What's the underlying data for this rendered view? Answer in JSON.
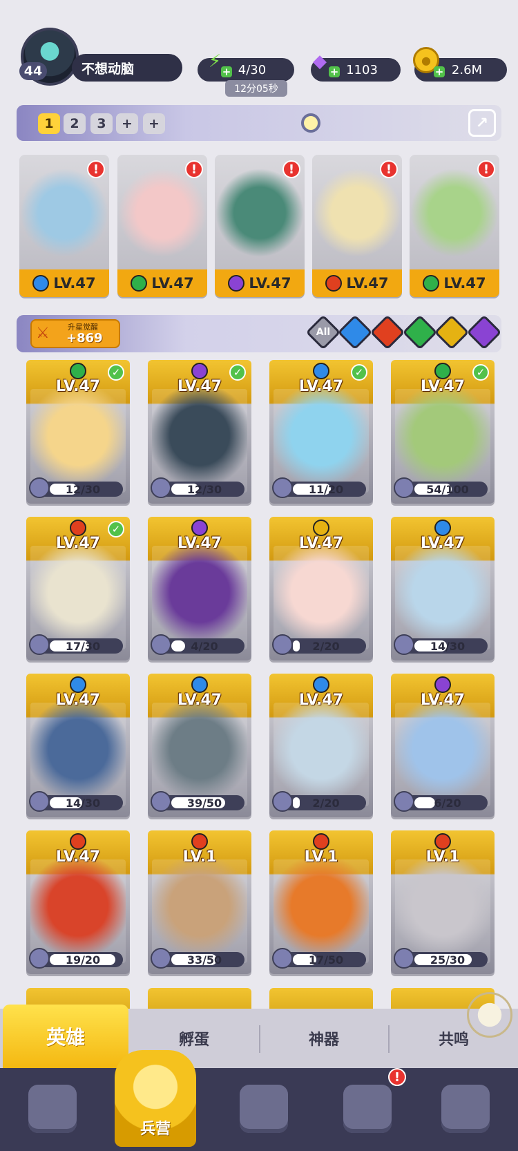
{
  "player": {
    "level": "44",
    "name": "不想动脑"
  },
  "resources": {
    "energy": {
      "value": "4/30",
      "timer": "12分05秒",
      "icon": "lightning-icon"
    },
    "gems": {
      "value": "1103",
      "icon": "diamond-icon"
    },
    "gold": {
      "value": "2.6M",
      "icon": "coin-icon"
    }
  },
  "team_tabs": [
    "1",
    "2",
    "3",
    "+",
    "+"
  ],
  "team": [
    {
      "level": "LV.47",
      "element": "water",
      "color": "#2f8ae8",
      "art": "#9ec9e4"
    },
    {
      "level": "LV.47",
      "element": "wind",
      "color": "#2fb04a",
      "art": "#f3c8c8"
    },
    {
      "level": "LV.47",
      "element": "shadow",
      "color": "#8a43d3",
      "art": "#4a8a78"
    },
    {
      "level": "LV.47",
      "element": "fire",
      "color": "#e0401f",
      "art": "#efe1b0"
    },
    {
      "level": "LV.47",
      "element": "wind",
      "color": "#2fb04a",
      "art": "#a8d38a"
    }
  ],
  "awaken": {
    "label": "升星觉醒",
    "value": "+869"
  },
  "filters": [
    {
      "label": "All",
      "color": "#9a9aa8"
    },
    {
      "label": "",
      "color": "#2f8ae8"
    },
    {
      "label": "",
      "color": "#e0401f"
    },
    {
      "label": "",
      "color": "#2fb04a"
    },
    {
      "label": "",
      "color": "#e5b212"
    },
    {
      "label": "",
      "color": "#8a43d3"
    }
  ],
  "heroes": [
    {
      "level": "LV.47",
      "shards": "12/30",
      "progress": 0.4,
      "element": "wind",
      "color": "#2fb04a",
      "check": true,
      "art": "#f5d58b"
    },
    {
      "level": "LV.47",
      "shards": "12/30",
      "progress": 0.4,
      "element": "shadow",
      "color": "#8a43d3",
      "check": true,
      "art": "#3a4b5a"
    },
    {
      "level": "LV.47",
      "shards": "11/20",
      "progress": 0.55,
      "element": "water",
      "color": "#2f8ae8",
      "check": true,
      "art": "#8fd3ee"
    },
    {
      "level": "LV.47",
      "shards": "54/100",
      "progress": 0.54,
      "element": "wind",
      "color": "#2fb04a",
      "check": true,
      "art": "#a3c97a"
    },
    {
      "level": "LV.47",
      "shards": "17/30",
      "progress": 0.57,
      "element": "fire",
      "color": "#e0401f",
      "check": true,
      "art": "#e9e3cf"
    },
    {
      "level": "LV.47",
      "shards": "4/20",
      "progress": 0.2,
      "element": "shadow",
      "color": "#8a43d3",
      "check": false,
      "art": "#6a3b9a"
    },
    {
      "level": "LV.47",
      "shards": "2/20",
      "progress": 0.1,
      "element": "light",
      "color": "#e5b212",
      "check": false,
      "art": "#f7d8d2"
    },
    {
      "level": "LV.47",
      "shards": "14/30",
      "progress": 0.47,
      "element": "water",
      "color": "#2f8ae8",
      "check": false,
      "art": "#b9d6ea"
    },
    {
      "level": "LV.47",
      "shards": "14/30",
      "progress": 0.47,
      "element": "water",
      "color": "#2f8ae8",
      "check": false,
      "art": "#4b6a9a"
    },
    {
      "level": "LV.47",
      "shards": "39/50",
      "progress": 0.78,
      "element": "water",
      "color": "#2f8ae8",
      "check": false,
      "art": "#6d7d86"
    },
    {
      "level": "LV.47",
      "shards": "2/20",
      "progress": 0.1,
      "element": "water",
      "color": "#2f8ae8",
      "check": false,
      "art": "#c4d7e5"
    },
    {
      "level": "LV.47",
      "shards": "6/20",
      "progress": 0.3,
      "element": "shadow",
      "color": "#8a43d3",
      "check": false,
      "art": "#9fc3ea"
    },
    {
      "level": "LV.47",
      "shards": "19/20",
      "progress": 0.95,
      "element": "fire",
      "color": "#e0401f",
      "check": false,
      "art": "#d9442a"
    },
    {
      "level": "LV.1",
      "shards": "33/50",
      "progress": 0.66,
      "element": "fire",
      "color": "#e0401f",
      "check": false,
      "art": "#c9a27a"
    },
    {
      "level": "LV.1",
      "shards": "17/50",
      "progress": 0.34,
      "element": "fire",
      "color": "#e0401f",
      "check": false,
      "art": "#e77a2a"
    },
    {
      "level": "LV.1",
      "shards": "25/30",
      "progress": 0.83,
      "element": "fire",
      "color": "#e0401f",
      "check": false,
      "art": "#c9c6cc"
    }
  ],
  "sub_tabs": [
    "英雄",
    "孵蛋",
    "神器",
    "共鸣"
  ],
  "nav": {
    "active_label": "兵营"
  }
}
